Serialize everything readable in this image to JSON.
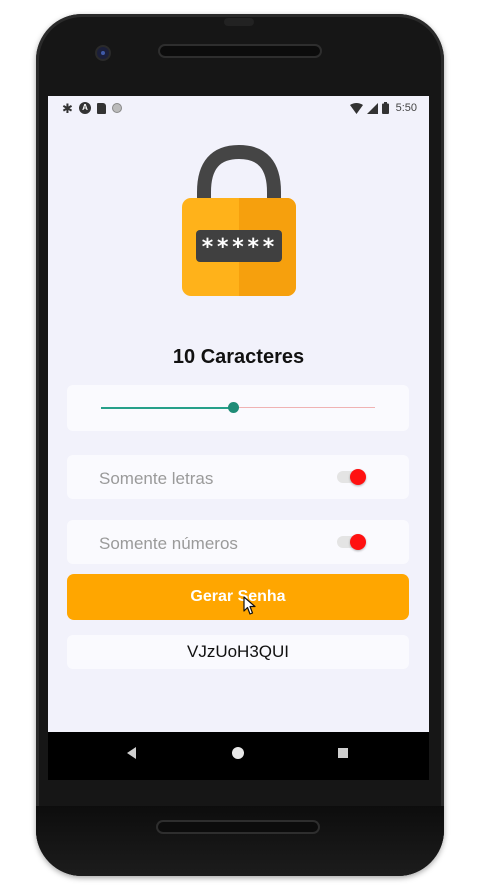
{
  "status_bar": {
    "icons_left": [
      "settings-icon",
      "app-a-icon",
      "sd-card-icon",
      "circle-icon"
    ],
    "icons_right": [
      "wifi-icon",
      "signal-icon",
      "battery-icon"
    ],
    "time": "5:50"
  },
  "lock_graphic": {
    "password_mask": "*****",
    "body_color": "#ffb21a",
    "shackle_color": "#454545"
  },
  "length_title": "10 Caracteres",
  "slider": {
    "value_fraction": 0.48,
    "active_color": "#26a08a",
    "inactive_color": "#f0b3b3"
  },
  "options": [
    {
      "label": "Somente letras",
      "toggle_state": "off"
    },
    {
      "label": "Somente números",
      "toggle_state": "off"
    }
  ],
  "generate_button_label": "Gerar Senha",
  "generated_password": "VJzUoH3QUI",
  "colors": {
    "accent": "#ffa600",
    "screen_background": "#f2f2fb",
    "switch_knob": "#ff1111"
  },
  "nav_bar": [
    "back-icon",
    "home-icon",
    "recent-apps-icon"
  ]
}
